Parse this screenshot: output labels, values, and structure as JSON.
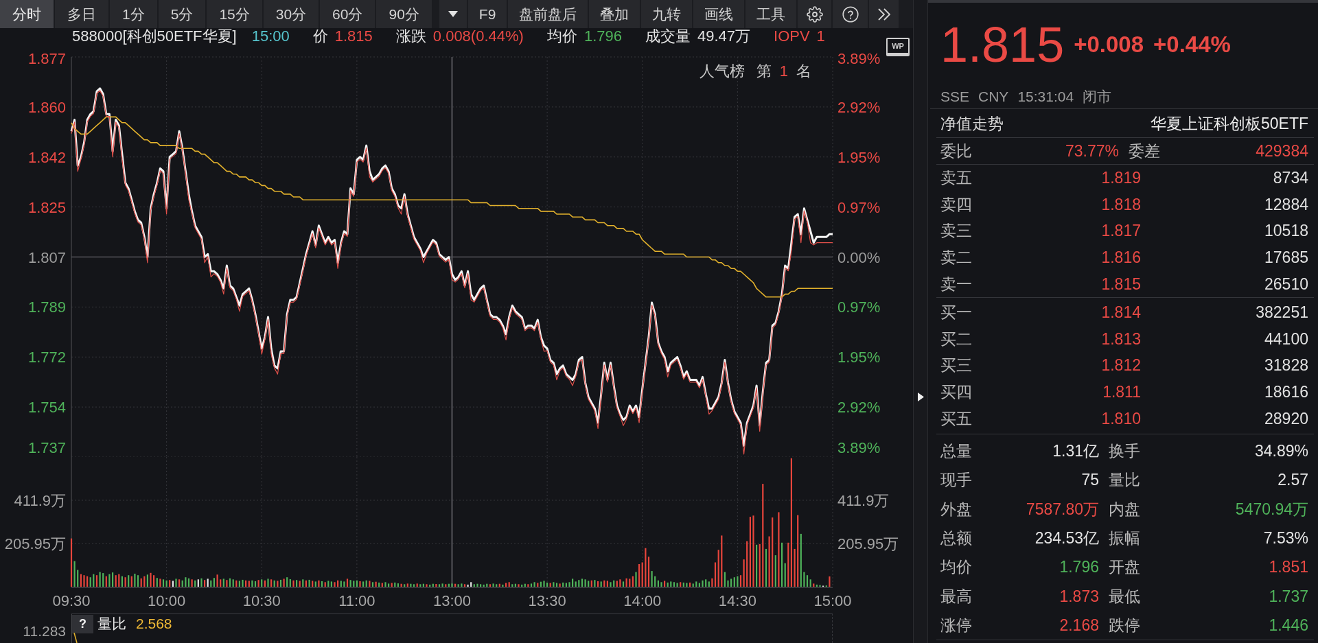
{
  "toolbar": {
    "tabs": [
      {
        "label": "分时",
        "selected": true
      },
      {
        "label": "多日",
        "selected": false
      },
      {
        "label": "1分",
        "selected": false
      },
      {
        "label": "5分",
        "selected": false
      },
      {
        "label": "15分",
        "selected": false
      },
      {
        "label": "30分",
        "selected": false
      },
      {
        "label": "60分",
        "selected": false
      },
      {
        "label": "90分",
        "selected": false
      }
    ],
    "tools": [
      "F9",
      "盘前盘后",
      "叠加",
      "九转",
      "画线",
      "工具"
    ]
  },
  "quote_header": {
    "symbol": "588000[科创50ETF华夏]",
    "time": "15:00",
    "fields": [
      {
        "label": "价",
        "value": "1.815",
        "color": "#ea4a45",
        "kind": "plain"
      },
      {
        "label": "涨跌",
        "value": "0.008(0.44%)",
        "color": "#ea4a45",
        "kind": "plain"
      },
      {
        "label": "均价",
        "value": "1.796",
        "color": "#4fb35a",
        "kind": "plain"
      },
      {
        "label": "成交量",
        "value": "49.47万",
        "color": "#e2e2e2",
        "kind": "plain"
      },
      {
        "label": "IOPV",
        "value": "1",
        "color": "#ea4a45",
        "kind": "tinted"
      }
    ],
    "badge": "WP"
  },
  "price_chart": {
    "chart_data": {
      "type": "line",
      "grid": true,
      "ylim": [
        1.737,
        1.877
      ],
      "yticks": [
        {
          "value": 1.877,
          "label": "1.877"
        },
        {
          "value": 1.8595,
          "label": "1.860"
        },
        {
          "value": 1.842,
          "label": "1.842"
        },
        {
          "value": 1.8245,
          "label": "1.825"
        },
        {
          "value": 1.807,
          "label": "1.807"
        },
        {
          "value": 1.7895,
          "label": "1.789"
        },
        {
          "value": 1.772,
          "label": "1.772"
        },
        {
          "value": 1.7545,
          "label": "1.754"
        },
        {
          "value": 1.737,
          "label": "1.737"
        }
      ],
      "ref_lines": [
        {
          "axis": "y",
          "value": 1.807
        }
      ],
      "categories": [
        null,
        null,
        null,
        null,
        null,
        null,
        null,
        null,
        null,
        null,
        null,
        null,
        null,
        null,
        null,
        null,
        null,
        null,
        null,
        null,
        null,
        null,
        null,
        null,
        null,
        null,
        null,
        null,
        null,
        null,
        null,
        null,
        null,
        null,
        null,
        null,
        null,
        null,
        null,
        null,
        null,
        null,
        null,
        null,
        null,
        null,
        null,
        null,
        null,
        null,
        null,
        null,
        null,
        null,
        null,
        null,
        null,
        null,
        null,
        null,
        null,
        null,
        null,
        null,
        null,
        null,
        null,
        null,
        null,
        null,
        null,
        null,
        null,
        null,
        null,
        null,
        null,
        null,
        null,
        null,
        null,
        null,
        null,
        null,
        null,
        null,
        null,
        null,
        null,
        null,
        null,
        null,
        null,
        null,
        null,
        null,
        null,
        null,
        null,
        null,
        null,
        null,
        null,
        null,
        null,
        null,
        null,
        null,
        null,
        null,
        null,
        null,
        null,
        null,
        null,
        null,
        null,
        null,
        null,
        null,
        null,
        null,
        null,
        null,
        null,
        null,
        null,
        null,
        null,
        null,
        null,
        null,
        null,
        null,
        null,
        null,
        null,
        null,
        null,
        null,
        null,
        null,
        null,
        null,
        null,
        null,
        null,
        null,
        null,
        null,
        null,
        null,
        null,
        null,
        null,
        null,
        null,
        null,
        null,
        null,
        null,
        null,
        null,
        null,
        null,
        null,
        null,
        null,
        null,
        null,
        null,
        null,
        null,
        null,
        null,
        null,
        null,
        null,
        null,
        null,
        null,
        null,
        null,
        null,
        null,
        null,
        null,
        null,
        null,
        null,
        null,
        null,
        null,
        null,
        null,
        null,
        null,
        null,
        null,
        null,
        null,
        null,
        null,
        null,
        null,
        null,
        null,
        null,
        null,
        null,
        null,
        null,
        null,
        null,
        null,
        null,
        null,
        null,
        null,
        null,
        null,
        null,
        null,
        null,
        null,
        null,
        null,
        null,
        null,
        null,
        null,
        null,
        null,
        null,
        null,
        null,
        null,
        null,
        null,
        null,
        null
      ],
      "series": [
        {
          "color": "#f4f4f4",
          "values": [
            1.851,
            1.855,
            1.839,
            1.842,
            1.847,
            1.855,
            1.857,
            1.858,
            1.865,
            1.866,
            1.864,
            1.857,
            1.857,
            1.844,
            1.855,
            1.853,
            1.843,
            1.833,
            1.831,
            1.827,
            1.823,
            1.82,
            1.819,
            1.814,
            1.807,
            1.824,
            1.829,
            1.833,
            1.838,
            1.837,
            1.824,
            1.842,
            1.843,
            1.844,
            1.851,
            1.845,
            1.837,
            1.829,
            1.823,
            1.818,
            1.816,
            1.814,
            1.807,
            1.808,
            1.802,
            1.802,
            1.801,
            1.799,
            1.796,
            1.804,
            1.797,
            1.796,
            1.793,
            1.79,
            1.794,
            1.795,
            1.796,
            1.792,
            1.787,
            1.781,
            1.775,
            1.779,
            1.786,
            1.775,
            1.769,
            1.768,
            1.774,
            1.774,
            1.787,
            1.792,
            1.792,
            1.793,
            1.798,
            1.803,
            1.808,
            1.812,
            1.816,
            1.811,
            1.818,
            1.815,
            1.812,
            1.814,
            1.812,
            1.813,
            1.805,
            1.812,
            1.816,
            1.815,
            1.831,
            1.829,
            1.841,
            1.842,
            1.841,
            1.846,
            1.837,
            1.834,
            1.835,
            1.836,
            1.838,
            1.839,
            1.837,
            1.831,
            1.829,
            1.825,
            1.824,
            1.829,
            1.822,
            1.818,
            1.814,
            1.812,
            1.81,
            1.807,
            1.809,
            1.811,
            1.813,
            1.812,
            1.808,
            1.807,
            1.806,
            1.807,
            1.801,
            1.799,
            1.8,
            1.802,
            1.797,
            1.802,
            1.794,
            1.792,
            1.794,
            1.796,
            1.797,
            1.792,
            1.787,
            1.786,
            1.786,
            1.785,
            1.783,
            1.78,
            1.786,
            1.79,
            1.788,
            1.787,
            1.786,
            1.782,
            1.783,
            1.783,
            1.782,
            1.785,
            1.779,
            1.776,
            1.775,
            1.771,
            1.77,
            1.766,
            1.768,
            1.769,
            1.766,
            1.765,
            1.764,
            1.766,
            1.771,
            1.772,
            1.763,
            1.758,
            1.756,
            1.754,
            1.749,
            1.759,
            1.77,
            1.764,
            1.77,
            1.762,
            1.755,
            1.752,
            1.75,
            1.751,
            1.755,
            1.753,
            1.755,
            1.751,
            1.761,
            1.77,
            1.779,
            1.791,
            1.787,
            1.777,
            1.774,
            1.772,
            1.767,
            1.77,
            1.771,
            1.772,
            1.769,
            1.765,
            1.767,
            1.764,
            1.764,
            1.764,
            1.762,
            1.765,
            1.759,
            1.754,
            1.754,
            1.756,
            1.758,
            1.763,
            1.771,
            1.763,
            1.757,
            1.753,
            1.751,
            1.749,
            1.741,
            1.749,
            1.752,
            1.755,
            1.762,
            1.748,
            1.76,
            1.77,
            1.771,
            1.783,
            1.784,
            1.788,
            1.794,
            1.804,
            1.803,
            1.812,
            1.821,
            1.822,
            1.815,
            1.824,
            1.82,
            1.816,
            1.812,
            1.814,
            1.814,
            1.814,
            1.814,
            1.815,
            1.815
          ]
        },
        {
          "color": "#e2b12c",
          "values": [
            1.854,
            1.852,
            1.851,
            1.85,
            1.85,
            1.85,
            1.851,
            1.852,
            1.853,
            1.854,
            1.855,
            1.856,
            1.856,
            1.856,
            1.856,
            1.855,
            1.854,
            1.854,
            1.853,
            1.852,
            1.851,
            1.85,
            1.849,
            1.848,
            1.848,
            1.847,
            1.847,
            1.847,
            1.846,
            1.846,
            1.846,
            1.846,
            1.846,
            1.846,
            1.845,
            1.845,
            1.845,
            1.845,
            1.845,
            1.844,
            1.844,
            1.843,
            1.843,
            1.842,
            1.841,
            1.84,
            1.84,
            1.839,
            1.838,
            1.837,
            1.837,
            1.836,
            1.836,
            1.835,
            1.835,
            1.835,
            1.834,
            1.834,
            1.833,
            1.833,
            1.832,
            1.832,
            1.831,
            1.831,
            1.83,
            1.83,
            1.83,
            1.829,
            1.829,
            1.829,
            1.828,
            1.828,
            1.828,
            1.827,
            1.827,
            1.827,
            1.827,
            1.827,
            1.827,
            1.827,
            1.827,
            1.827,
            1.827,
            1.827,
            1.827,
            1.827,
            1.827,
            1.827,
            1.827,
            1.827,
            1.827,
            1.827,
            1.827,
            1.827,
            1.827,
            1.827,
            1.827,
            1.827,
            1.827,
            1.827,
            1.827,
            1.827,
            1.827,
            1.827,
            1.827,
            1.827,
            1.827,
            1.827,
            1.827,
            1.827,
            1.827,
            1.827,
            1.827,
            1.827,
            1.827,
            1.827,
            1.827,
            1.827,
            1.827,
            1.827,
            1.827,
            1.827,
            1.827,
            1.827,
            1.827,
            1.827,
            1.826,
            1.826,
            1.826,
            1.826,
            1.826,
            1.826,
            1.825,
            1.825,
            1.825,
            1.825,
            1.825,
            1.825,
            1.825,
            1.825,
            1.825,
            1.824,
            1.824,
            1.824,
            1.824,
            1.824,
            1.824,
            1.824,
            1.823,
            1.823,
            1.823,
            1.823,
            1.823,
            1.822,
            1.822,
            1.822,
            1.822,
            1.822,
            1.821,
            1.821,
            1.821,
            1.821,
            1.82,
            1.82,
            1.82,
            1.82,
            1.819,
            1.819,
            1.819,
            1.818,
            1.818,
            1.818,
            1.817,
            1.817,
            1.817,
            1.816,
            1.816,
            1.816,
            1.815,
            1.815,
            1.813,
            1.812,
            1.811,
            1.81,
            1.809,
            1.809,
            1.809,
            1.808,
            1.808,
            1.808,
            1.808,
            1.808,
            1.808,
            1.808,
            1.807,
            1.807,
            1.807,
            1.807,
            1.807,
            1.807,
            1.807,
            1.807,
            1.806,
            1.806,
            1.805,
            1.805,
            1.804,
            1.804,
            1.803,
            1.803,
            1.802,
            1.802,
            1.801,
            1.8,
            1.799,
            1.798,
            1.796,
            1.795,
            1.794,
            1.793,
            1.793,
            1.793,
            1.793,
            1.793,
            1.793,
            1.794,
            1.794,
            1.795,
            1.795,
            1.796,
            1.796,
            1.796,
            1.796,
            1.796,
            1.796,
            1.796,
            1.796,
            1.796,
            1.796,
            1.796,
            1.796
          ]
        },
        {
          "color": "#e0504a",
          "values": [
            1.8502,
            1.8542,
            1.837,
            1.8412,
            1.8462,
            1.8542,
            1.8562,
            1.8572,
            1.8642,
            1.8652,
            1.8632,
            1.8562,
            1.8562,
            1.842,
            1.8542,
            1.8522,
            1.841,
            1.8322,
            1.8302,
            1.8262,
            1.8222,
            1.8192,
            1.8182,
            1.8132,
            1.805,
            1.8232,
            1.8282,
            1.8322,
            1.8372,
            1.8362,
            1.822,
            1.8412,
            1.8422,
            1.8432,
            1.8502,
            1.8442,
            1.8362,
            1.827,
            1.8222,
            1.8172,
            1.8152,
            1.8132,
            1.805,
            1.8072,
            1.8,
            1.8012,
            1.8002,
            1.7982,
            1.794,
            1.8032,
            1.7962,
            1.7952,
            1.7922,
            1.788,
            1.7932,
            1.7942,
            1.7952,
            1.7912,
            1.7862,
            1.7802,
            1.773,
            1.7782,
            1.7852,
            1.773,
            1.7682,
            1.766,
            1.7732,
            1.7732,
            1.7862,
            1.7912,
            1.7912,
            1.7922,
            1.7972,
            1.8022,
            1.8072,
            1.8112,
            1.8152,
            1.8102,
            1.8172,
            1.8142,
            1.8112,
            1.8132,
            1.8112,
            1.8122,
            1.803,
            1.8112,
            1.8152,
            1.8142,
            1.8302,
            1.8282,
            1.8402,
            1.8412,
            1.8402,
            1.8452,
            1.835,
            1.8332,
            1.8342,
            1.8352,
            1.8372,
            1.8382,
            1.8362,
            1.8302,
            1.8282,
            1.8242,
            1.822,
            1.8282,
            1.8212,
            1.8172,
            1.8132,
            1.8112,
            1.8092,
            1.805,
            1.8082,
            1.8102,
            1.8122,
            1.8112,
            1.8072,
            1.8062,
            1.8052,
            1.8062,
            1.799,
            1.7982,
            1.7992,
            1.8012,
            1.7962,
            1.8012,
            1.792,
            1.7912,
            1.7932,
            1.7952,
            1.7962,
            1.7912,
            1.7862,
            1.7852,
            1.7852,
            1.7842,
            1.7822,
            1.778,
            1.7852,
            1.7892,
            1.7872,
            1.7862,
            1.7852,
            1.7812,
            1.7822,
            1.7822,
            1.7812,
            1.7842,
            1.7782,
            1.774,
            1.7742,
            1.7702,
            1.7692,
            1.764,
            1.7672,
            1.7682,
            1.7652,
            1.7642,
            1.762,
            1.7652,
            1.7702,
            1.7712,
            1.7622,
            1.7572,
            1.7552,
            1.7532,
            1.747,
            1.7582,
            1.7692,
            1.7632,
            1.7692,
            1.7612,
            1.7542,
            1.7512,
            1.748,
            1.7502,
            1.7542,
            1.7522,
            1.7542,
            1.749,
            1.7602,
            1.7692,
            1.7782,
            1.7902,
            1.7862,
            1.7762,
            1.7732,
            1.7712,
            1.765,
            1.7692,
            1.7702,
            1.7712,
            1.7682,
            1.7642,
            1.7662,
            1.7632,
            1.7632,
            1.7632,
            1.7612,
            1.7642,
            1.7582,
            1.752,
            1.7532,
            1.7552,
            1.7572,
            1.7622,
            1.7702,
            1.7622,
            1.7562,
            1.7522,
            1.7502,
            1.7482,
            1.738,
            1.7482,
            1.7512,
            1.7542,
            1.7612,
            1.746,
            1.7592,
            1.7692,
            1.7702,
            1.7822,
            1.7832,
            1.7872,
            1.7932,
            1.8032,
            1.8022,
            1.809,
            1.8202,
            1.8212,
            1.812,
            1.8232,
            1.8192,
            1.812,
            1.8112,
            1.812,
            1.812,
            1.812,
            1.812,
            1.812,
            1.812
          ]
        }
      ]
    },
    "right_ticks": [
      "3.89%",
      "2.92%",
      "1.95%",
      "0.97%",
      "0.00%",
      "0.97%",
      "1.95%",
      "2.92%",
      "3.89%"
    ],
    "popularity": {
      "label": "人气榜",
      "prefix": "第",
      "rank": "1",
      "suffix": "名"
    }
  },
  "volume_chart": {
    "chart_data": {
      "type": "bar",
      "grid": true,
      "ylim": [
        0,
        617.85
      ],
      "yticks": [
        {
          "value": 411.9,
          "label": "411.9万"
        },
        {
          "value": 205.95,
          "label": "205.95万"
        }
      ],
      "categories": [
        "09:30",
        null,
        null,
        null,
        null,
        null,
        null,
        null,
        null,
        null,
        null,
        null,
        null,
        null,
        null,
        null,
        null,
        null,
        null,
        null,
        null,
        null,
        null,
        null,
        null,
        null,
        null,
        null,
        null,
        null,
        "10:00",
        null,
        null,
        null,
        null,
        null,
        null,
        null,
        null,
        null,
        null,
        null,
        null,
        null,
        null,
        null,
        null,
        null,
        null,
        null,
        null,
        null,
        null,
        null,
        null,
        null,
        null,
        null,
        null,
        null,
        "10:30",
        null,
        null,
        null,
        null,
        null,
        null,
        null,
        null,
        null,
        null,
        null,
        null,
        null,
        null,
        null,
        null,
        null,
        null,
        null,
        null,
        null,
        null,
        null,
        null,
        null,
        null,
        null,
        null,
        null,
        "11:00",
        null,
        null,
        null,
        null,
        null,
        null,
        null,
        null,
        null,
        null,
        null,
        null,
        null,
        null,
        null,
        null,
        null,
        null,
        null,
        null,
        null,
        null,
        null,
        null,
        null,
        null,
        null,
        null,
        null,
        "13:00",
        null,
        null,
        null,
        null,
        null,
        null,
        null,
        null,
        null,
        null,
        null,
        null,
        null,
        null,
        null,
        null,
        null,
        null,
        null,
        null,
        null,
        null,
        null,
        null,
        null,
        null,
        null,
        null,
        null,
        "13:30",
        null,
        null,
        null,
        null,
        null,
        null,
        null,
        null,
        null,
        null,
        null,
        null,
        null,
        null,
        null,
        null,
        null,
        null,
        null,
        null,
        null,
        null,
        null,
        null,
        null,
        null,
        null,
        null,
        null,
        "14:00",
        null,
        null,
        null,
        null,
        null,
        null,
        null,
        null,
        null,
        null,
        null,
        null,
        null,
        null,
        null,
        null,
        null,
        null,
        null,
        null,
        null,
        null,
        null,
        null,
        null,
        null,
        null,
        null,
        null,
        "14:30",
        null,
        null,
        null,
        null,
        null,
        null,
        null,
        null,
        null,
        null,
        null,
        null,
        null,
        null,
        null,
        null,
        null,
        null,
        null,
        null,
        null,
        null,
        null,
        null,
        null,
        null,
        null,
        null,
        null,
        "15:00"
      ],
      "series": [
        {
          "color": "#e8453c",
          "values": [
            230,
            null,
            null,
            60,
            55,
            50,
            null,
            null,
            55,
            null,
            null,
            50,
            null,
            null,
            55,
            60,
            null,
            45,
            null,
            50,
            null,
            null,
            40,
            50,
            null,
            66,
            55,
            null,
            38,
            null,
            null,
            32,
            null,
            null,
            35,
            null,
            null,
            null,
            35,
            null,
            null,
            null,
            32,
            null,
            null,
            null,
            58,
            35,
            null,
            32,
            null,
            null,
            30,
            null,
            null,
            30,
            28,
            null,
            null,
            32,
            null,
            30,
            null,
            35,
            null,
            28,
            null,
            38,
            null,
            null,
            30,
            null,
            28,
            null,
            30,
            null,
            28,
            null,
            30,
            null,
            22,
            null,
            null,
            22,
            30,
            null,
            null,
            38,
            null,
            null,
            null,
            26,
            null,
            null,
            28,
            null,
            24,
            null,
            18,
            null,
            null,
            18,
            null,
            null,
            14,
            null,
            15,
            null,
            null,
            15,
            null,
            null,
            12,
            null,
            null,
            13,
            null,
            null,
            12,
            null,
            null,
            14,
            null,
            null,
            12,
            null,
            null,
            null,
            null,
            null,
            null,
            null,
            12,
            null,
            null,
            14,
            null,
            18,
            22,
            null,
            null,
            12,
            null,
            null,
            12,
            null,
            null,
            18,
            null,
            null,
            null,
            18,
            null,
            null,
            15,
            null,
            null,
            null,
            null,
            null,
            null,
            null,
            null,
            null,
            30,
            null,
            26,
            null,
            30,
            28,
            null,
            null,
            28,
            35,
            null,
            40,
            38,
            50,
            null,
            108,
            116,
            184,
            143,
            null,
            null,
            null,
            null,
            28,
            null,
            null,
            null,
            null,
            22,
            null,
            null,
            20,
            null,
            null,
            null,
            null,
            null,
            null,
            40,
            116,
            176,
            244,
            null,
            null,
            null,
            null,
            null,
            55,
            130,
            217,
            333,
            339,
            null,
            203,
            490,
            null,
            240,
            330,
            null,
            355,
            null,
            null,
            210,
            612,
            180,
            341,
            null,
            null,
            null,
            null,
            15,
            null,
            null,
            null,
            null,
            49,
            null
          ]
        },
        {
          "color": "#4fb35a",
          "values": [
            null,
            122,
            80,
            null,
            null,
            null,
            45,
            60,
            null,
            70,
            65,
            null,
            60,
            68,
            null,
            null,
            50,
            null,
            55,
            null,
            62,
            55,
            null,
            null,
            58,
            null,
            null,
            42,
            null,
            35,
            30,
            null,
            null,
            38,
            null,
            30,
            45,
            40,
            null,
            30,
            null,
            40,
            null,
            null,
            30,
            42,
            null,
            null,
            38,
            null,
            40,
            35,
            null,
            28,
            33,
            null,
            null,
            30,
            26,
            null,
            35,
            null,
            38,
            null,
            30,
            null,
            33,
            null,
            45,
            36,
            null,
            32,
            null,
            35,
            null,
            33,
            null,
            25,
            null,
            26,
            null,
            28,
            25,
            null,
            null,
            28,
            25,
            null,
            32,
            28,
            30,
            null,
            25,
            30,
            null,
            22,
            null,
            20,
            null,
            22,
            15,
            null,
            20,
            16,
            null,
            12,
            null,
            14,
            12,
            null,
            12,
            14,
            null,
            10,
            14,
            null,
            12,
            15,
            null,
            14,
            15,
            null,
            12,
            15,
            null,
            null,
            null,
            12,
            14,
            12,
            10,
            14,
            null,
            15,
            12,
            null,
            10,
            null,
            null,
            12,
            14,
            null,
            10,
            14,
            null,
            15,
            22,
            null,
            24,
            28,
            20,
            null,
            22,
            18,
            null,
            20,
            18,
            22,
            38,
            25,
            32,
            38,
            35,
            28,
            null,
            32,
            null,
            25,
            null,
            null,
            22,
            30,
            null,
            null,
            25,
            null,
            null,
            null,
            70,
            null,
            null,
            null,
            null,
            75,
            50,
            30,
            22,
            null,
            20,
            25,
            22,
            18,
            null,
            20,
            18,
            null,
            15,
            25,
            18,
            30,
            35,
            25,
            null,
            null,
            null,
            null,
            70,
            30,
            38,
            45,
            50,
            null,
            null,
            null,
            null,
            null,
            200,
            null,
            null,
            180,
            null,
            null,
            150,
            null,
            210,
            112,
            null,
            null,
            null,
            null,
            252,
            70,
            55,
            35,
            null,
            10,
            8,
            null,
            6,
            null,
            null
          ]
        },
        {
          "color": "#e6e6e6",
          "values": [
            null,
            null,
            null,
            null,
            null,
            null,
            null,
            null,
            null,
            null,
            null,
            null,
            null,
            null,
            null,
            null,
            null,
            null,
            null,
            null,
            null,
            null,
            null,
            null,
            null,
            null,
            null,
            null,
            null,
            null,
            null,
            null,
            28,
            null,
            null,
            null,
            null,
            null,
            null,
            null,
            35,
            null,
            null,
            38,
            null,
            null,
            null,
            null,
            null,
            null,
            null,
            null,
            null,
            null,
            null,
            null,
            null,
            null,
            null,
            null,
            null,
            null,
            null,
            null,
            null,
            null,
            null,
            null,
            null,
            null,
            null,
            null,
            null,
            null,
            null,
            null,
            null,
            null,
            null,
            null,
            null,
            null,
            null,
            null,
            null,
            null,
            null,
            null,
            null,
            null,
            null,
            null,
            null,
            null,
            null,
            null,
            null,
            null,
            null,
            null,
            null,
            null,
            null,
            null,
            null,
            null,
            null,
            null,
            null,
            null,
            null,
            null,
            null,
            null,
            null,
            null,
            null,
            null,
            null,
            null,
            null,
            null,
            null,
            null,
            null,
            10,
            22,
            null,
            null,
            null,
            null,
            null,
            null,
            null,
            null,
            null,
            null,
            null,
            null,
            null,
            null,
            null,
            null,
            null,
            null,
            null,
            null,
            null,
            null,
            null,
            null,
            null,
            null,
            null,
            null,
            null,
            null,
            null,
            null,
            null,
            null,
            null,
            null,
            null,
            null,
            null,
            null,
            null,
            null,
            null,
            null,
            null,
            null,
            null,
            null,
            null,
            null,
            null,
            null,
            null,
            null,
            null,
            null,
            null,
            null,
            null,
            null,
            null,
            null,
            null,
            null,
            null,
            null,
            null,
            null,
            null,
            null,
            null,
            null,
            null,
            null,
            null,
            null,
            null,
            null,
            null,
            null,
            null,
            null,
            null,
            null,
            null,
            null,
            null,
            null,
            null,
            null,
            null,
            null,
            null,
            null,
            null,
            null,
            null,
            null,
            null,
            null,
            null,
            null,
            null,
            null,
            null,
            null,
            null,
            null,
            null,
            null,
            5,
            null,
            null,
            null
          ]
        }
      ]
    },
    "right_ticks": [
      "411.9万",
      "205.95万"
    ]
  },
  "indicator": {
    "help": "?",
    "label": "量比",
    "value": "2.568",
    "axis_label": "11.283"
  },
  "quote": {
    "price": "1.815",
    "change": "+0.008",
    "change_pct": "+0.44%",
    "exchange": "SSE",
    "currency": "CNY",
    "time": "15:31:04",
    "status": "闭市"
  },
  "nav": {
    "label": "净值走势",
    "fund_name": "华夏上证科创板50ETF"
  },
  "order_ratio": [
    {
      "label": "委比",
      "value": "73.77%",
      "color": "#ea4a45"
    },
    {
      "label": "委差",
      "value": "429384",
      "color": "#ea4a45"
    }
  ],
  "asks": [
    {
      "label": "卖五",
      "price": "1.819",
      "volume": "8734"
    },
    {
      "label": "卖四",
      "price": "1.818",
      "volume": "12884"
    },
    {
      "label": "卖三",
      "price": "1.817",
      "volume": "10518"
    },
    {
      "label": "卖二",
      "price": "1.816",
      "volume": "17685"
    },
    {
      "label": "卖一",
      "price": "1.815",
      "volume": "26510"
    }
  ],
  "bids": [
    {
      "label": "买一",
      "price": "1.814",
      "volume": "382251"
    },
    {
      "label": "买二",
      "price": "1.813",
      "volume": "44100"
    },
    {
      "label": "买三",
      "price": "1.812",
      "volume": "31828"
    },
    {
      "label": "买四",
      "price": "1.811",
      "volume": "18616"
    },
    {
      "label": "买五",
      "price": "1.810",
      "volume": "28920"
    }
  ],
  "stats": [
    {
      "label": "总量",
      "value": "1.31亿",
      "color": "#e6e6e6"
    },
    {
      "label": "换手",
      "value": "34.89%",
      "color": "#e6e6e6"
    },
    {
      "label": "现手",
      "value": "75",
      "color": "#e6e6e6"
    },
    {
      "label": "量比",
      "value": "2.57",
      "color": "#e6e6e6"
    },
    {
      "label": "外盘",
      "value": "7587.80万",
      "color": "#ea4a45"
    },
    {
      "label": "内盘",
      "value": "5470.94万",
      "color": "#4fb35a"
    },
    {
      "label": "总额",
      "value": "234.53亿",
      "color": "#e6e6e6"
    },
    {
      "label": "振幅",
      "value": "7.53%",
      "color": "#e6e6e6"
    },
    {
      "label": "均价",
      "value": "1.796",
      "color": "#4fb35a"
    },
    {
      "label": "开盘",
      "value": "1.851",
      "color": "#ea4a45"
    },
    {
      "label": "最高",
      "value": "1.873",
      "color": "#ea4a45"
    },
    {
      "label": "最低",
      "value": "1.737",
      "color": "#4fb35a"
    },
    {
      "label": "涨停",
      "value": "2.168",
      "color": "#ea4a45"
    },
    {
      "label": "跌停",
      "value": "1.446",
      "color": "#4fb35a"
    }
  ]
}
